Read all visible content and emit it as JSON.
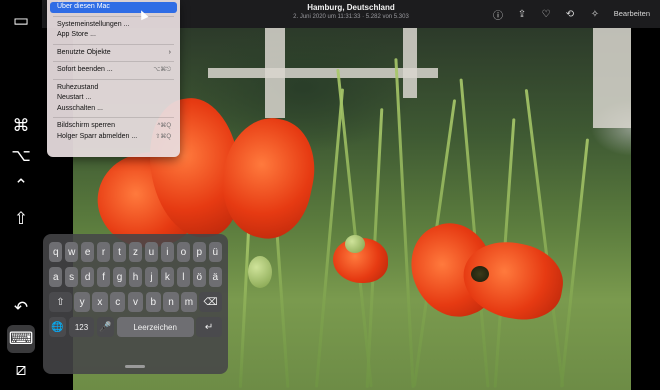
{
  "topbar": {
    "title": "Hamburg, Deutschland",
    "subtitle": "2. Juni 2020 um 11:31:33  ·  5.282 von 5.303",
    "edit_label": "Bearbeiten",
    "icons": [
      "info-icon",
      "share-icon",
      "heart-icon",
      "rotate-icon",
      "magic-wand-icon"
    ]
  },
  "sidebar": {
    "items": [
      "display-icon",
      "command-icon",
      "option-icon",
      "control-icon",
      "shift-icon",
      "undo-icon",
      "keyboard-icon",
      "hide-sidebar-icon"
    ]
  },
  "apple_menu": {
    "items": [
      {
        "label": "Über diesen Mac"
      },
      {
        "label": "Systemeinstellungen ..."
      },
      {
        "label": "App Store ..."
      },
      {
        "label": "Benutzte Objekte"
      },
      {
        "label": "Sofort beenden ...",
        "shortcut": "⌥⌘⎋"
      },
      {
        "label": "Ruhezustand"
      },
      {
        "label": "Neustart ..."
      },
      {
        "label": "Ausschalten ..."
      },
      {
        "label": "Bildschirm sperren",
        "shortcut": "^⌘Q"
      },
      {
        "label": "Holger Sparr abmelden ...",
        "shortcut": "⇧⌘Q"
      }
    ]
  },
  "keyboard": {
    "row1": [
      "q",
      "w",
      "e",
      "r",
      "t",
      "z",
      "u",
      "i",
      "o",
      "p",
      "ü"
    ],
    "row2": [
      "a",
      "s",
      "d",
      "f",
      "g",
      "h",
      "j",
      "k",
      "l",
      "ö",
      "ä"
    ],
    "row3": [
      "y",
      "x",
      "c",
      "v",
      "b",
      "n",
      "m"
    ],
    "numbers_label": "123",
    "space_label": "Leerzeichen"
  },
  "colors": {
    "menu_highlight": "#2f6ce5",
    "topbar": "#1c1c1e"
  }
}
